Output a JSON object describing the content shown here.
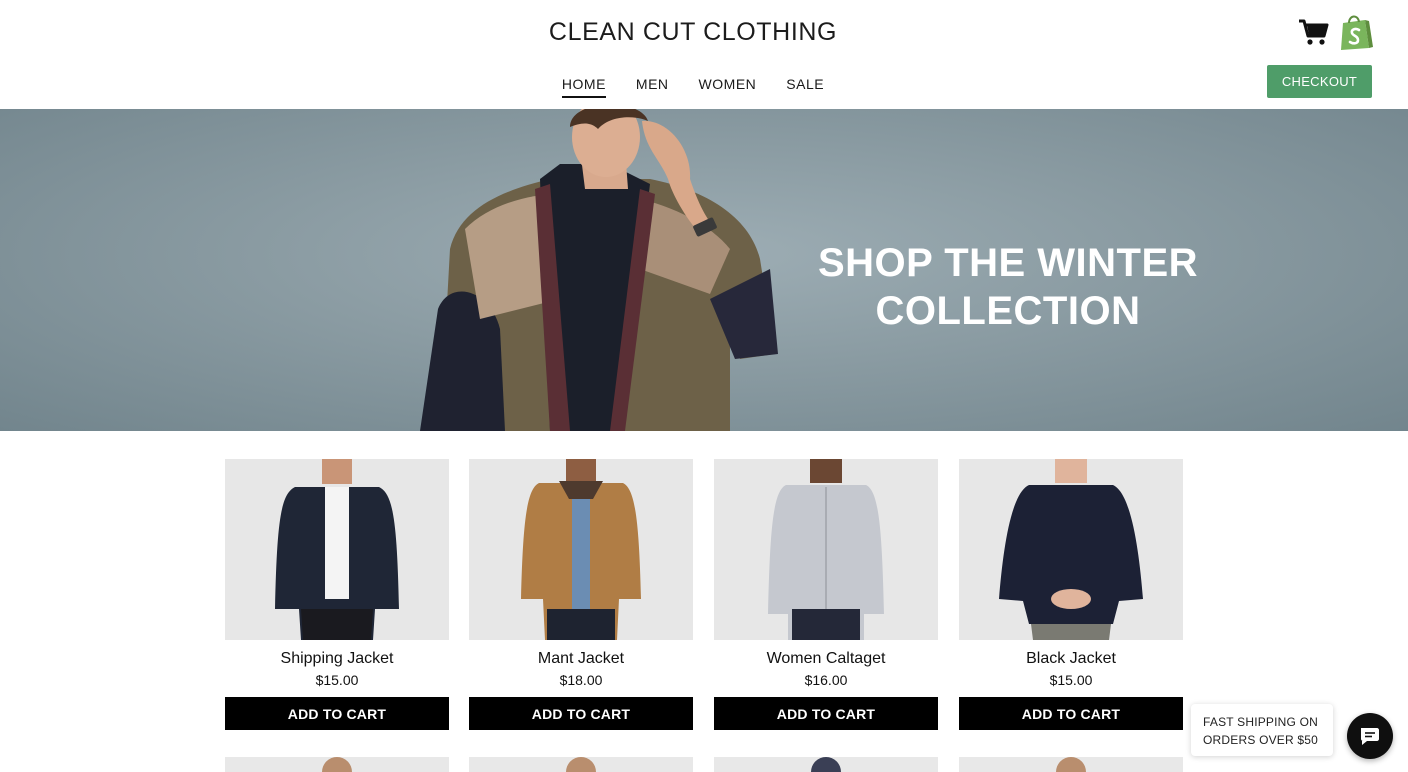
{
  "header": {
    "store_name": "CLEAN CUT CLOTHING",
    "nav": [
      {
        "label": "HOME",
        "active": true
      },
      {
        "label": "MEN",
        "active": false
      },
      {
        "label": "WOMEN",
        "active": false
      },
      {
        "label": "SALE",
        "active": false
      }
    ],
    "checkout_label": "CHECKOUT",
    "icons": [
      "cart-icon",
      "shopify-bag-icon"
    ],
    "accent_color": "#4f9d69"
  },
  "hero": {
    "heading_line1": "SHOP THE WINTER",
    "heading_line2": "COLLECTION",
    "background_color": "#8a9ba2"
  },
  "products": [
    {
      "name": "Shipping Jacket",
      "price": "$15.00",
      "button": "ADD TO CART",
      "garment_color": "#1f2636"
    },
    {
      "name": "Mant Jacket",
      "price": "$18.00",
      "button": "ADD TO CART",
      "garment_color": "#b07d45"
    },
    {
      "name": "Women Caltaget",
      "price": "$16.00",
      "button": "ADD TO CART",
      "garment_color": "#c5c8cf"
    },
    {
      "name": "Black Jacket",
      "price": "$15.00",
      "button": "ADD TO CART",
      "garment_color": "#1c2135"
    }
  ],
  "shipping_notice": {
    "line1": "FAST SHIPPING ON",
    "line2": "ORDERS OVER $50"
  },
  "chat": {
    "icon": "chat-icon"
  }
}
